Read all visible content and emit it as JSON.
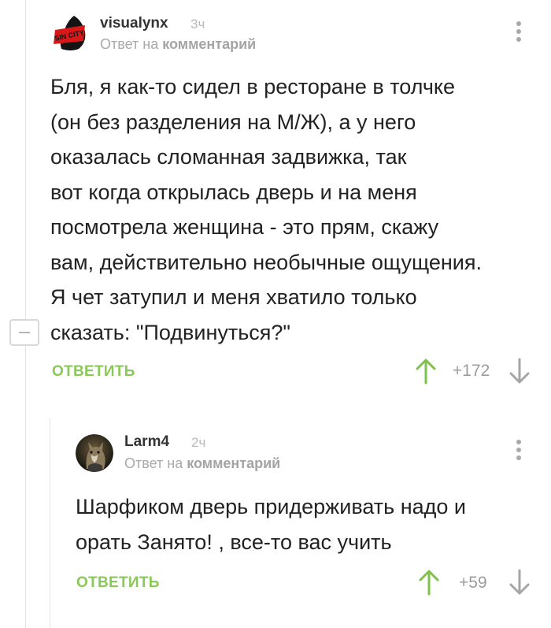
{
  "comments": [
    {
      "username": "visualynx",
      "time": "3ч",
      "reply_prefix": "Ответ на",
      "reply_target": "комментарий",
      "text": "Бля, я как-то сидел в ресторане в толчке\n(он без разделения на М/Ж), а у него\nоказалась сломанная задвижка, так\nвот когда открылась дверь и на меня\nпосмотрела женщина - это прям, скажу\nвам, действительно необычные ощущения.\nЯ чет затупил и меня хватило только\nсказать: \"Подвинуться?\"",
      "reply_label": "ОТВЕТИТЬ",
      "rating": "+172",
      "avatar_text": "SIN CITY",
      "icons": {
        "more": "more-vertical-icon",
        "up": "arrow-up-icon",
        "down": "arrow-down-icon",
        "collapse": "minus-icon"
      }
    },
    {
      "username": "Larm4",
      "time": "2ч",
      "reply_prefix": "Ответ на",
      "reply_target": "комментарий",
      "text": "Шарфиком дверь придерживать надо и\nорать Занято! , все-то вас учить",
      "reply_label": "ОТВЕТИТЬ",
      "rating": "+59"
    }
  ],
  "colors": {
    "accent_green": "#8ac858",
    "arrow_up": "#7ec14b",
    "arrow_down": "#a5a5a5",
    "muted_text": "#a9a9a9",
    "thread_line": "#e3e3e3"
  }
}
